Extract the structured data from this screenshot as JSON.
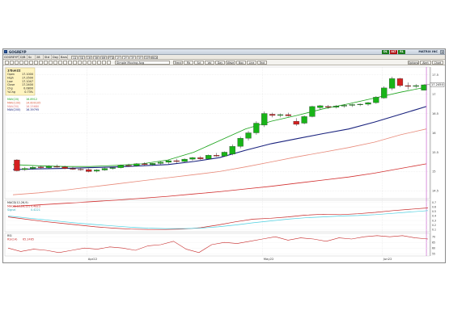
{
  "window": {
    "title": "GOGREYP",
    "title_right": "MATRIX INC",
    "status_buttons": [
      {
        "label": "DL",
        "color": "#1a7a1a"
      },
      {
        "label": "ALT",
        "color": "#b01414"
      },
      {
        "label": "RL",
        "color": "#1a7a1a"
      }
    ]
  },
  "toolbar1": {
    "symbol_field": "GOGREYP",
    "items": [
      "D/B",
      "Sc",
      "28",
      "Std",
      "Day",
      "Bars"
    ],
    "period_buttons": [
      "1D",
      "5D",
      "1M",
      "3M",
      "6M",
      "YTD",
      "1Y",
      "2Y",
      "3Y",
      "5Y",
      "10Y",
      "MAX"
    ]
  },
  "toolbar2": {
    "combo": "Simple Moving Avg",
    "menus": [
      "Trend",
      "Fib",
      "Sct",
      "Vol",
      "Day",
      "Wave",
      "Box",
      "Line",
      "Text"
    ],
    "right_buttons": [
      "Options",
      "Alert",
      "Chart"
    ]
  },
  "legend": {
    "header": "17Jun22",
    "fields": [
      {
        "label": "Open",
        "value": "17.1000"
      },
      {
        "label": "High",
        "value": "17.2500"
      },
      {
        "label": "Low",
        "value": "17.1047"
      },
      {
        "label": "Close",
        "value": "17.2400"
      },
      {
        "label": "Chg",
        "value": "0.0800"
      },
      {
        "label": "%Chg",
        "value": "0.73%"
      }
    ],
    "ma_lines": [
      {
        "label": "MAV(20)",
        "value": "16.8912",
        "color": "#1aa31a"
      },
      {
        "label": "MAV(100)",
        "value": "14.600105",
        "color": "#d95a3c"
      },
      {
        "label": "MAV(50)",
        "value": "16.25680",
        "color": "#e07474"
      },
      {
        "label": "MAV(200)",
        "value": "16.39795",
        "color": "#1a237e"
      }
    ]
  },
  "macd": {
    "title": "MACD(12,26,9)",
    "line": "MACD(12,26,12)",
    "value": "0.4823",
    "signal_label": "Signal",
    "signal_value": "0.4221"
  },
  "rsi": {
    "title": "RSI",
    "line": "RSI(14)",
    "value": "65.2465"
  },
  "price_box": "17.2450",
  "x_labels": [
    "Apr22",
    "May22",
    "Jun22"
  ],
  "price_ticks": [
    "17.5",
    "17",
    "16.5",
    "16",
    "15.5",
    "15",
    "14.5"
  ],
  "macd_ticks": [
    "0.7",
    "0.6",
    "0.5",
    "0.4",
    "0.3",
    "0.2",
    "0.1"
  ],
  "rsi_ticks": [
    "70",
    "65",
    "60",
    "55"
  ],
  "chart_data": [
    {
      "type": "line",
      "title": "GOGREYP",
      "subtitle": "Daily candlestick with moving averages",
      "x_range": [
        "2022-03-18",
        "2022-06-17"
      ],
      "ylim": [
        14.3,
        17.7
      ],
      "candles": [
        {
          "o": 15.3,
          "h": 15.32,
          "l": 15.0,
          "c": 15.02
        },
        {
          "o": 15.05,
          "h": 15.12,
          "l": 15.02,
          "c": 15.08
        },
        {
          "o": 15.08,
          "h": 15.14,
          "l": 15.05,
          "c": 15.11
        },
        {
          "o": 15.12,
          "h": 15.15,
          "l": 15.07,
          "c": 15.1
        },
        {
          "o": 15.1,
          "h": 15.16,
          "l": 15.08,
          "c": 15.14
        },
        {
          "o": 15.13,
          "h": 15.18,
          "l": 15.1,
          "c": 15.12
        },
        {
          "o": 15.12,
          "h": 15.15,
          "l": 15.06,
          "c": 15.08
        },
        {
          "o": 15.08,
          "h": 15.12,
          "l": 15.04,
          "c": 15.06
        },
        {
          "o": 15.06,
          "h": 15.1,
          "l": 15.02,
          "c": 15.05
        },
        {
          "o": 15.05,
          "h": 15.08,
          "l": 14.98,
          "c": 15.0
        },
        {
          "o": 15.01,
          "h": 15.06,
          "l": 14.98,
          "c": 15.04
        },
        {
          "o": 15.04,
          "h": 15.1,
          "l": 15.02,
          "c": 15.08
        },
        {
          "o": 15.08,
          "h": 15.12,
          "l": 15.05,
          "c": 15.1
        },
        {
          "o": 15.1,
          "h": 15.18,
          "l": 15.08,
          "c": 15.16
        },
        {
          "o": 15.16,
          "h": 15.2,
          "l": 15.12,
          "c": 15.15
        },
        {
          "o": 15.15,
          "h": 15.22,
          "l": 15.13,
          "c": 15.2
        },
        {
          "o": 15.2,
          "h": 15.24,
          "l": 15.16,
          "c": 15.18
        },
        {
          "o": 15.18,
          "h": 15.22,
          "l": 15.15,
          "c": 15.21
        },
        {
          "o": 15.21,
          "h": 15.26,
          "l": 15.18,
          "c": 15.24
        },
        {
          "o": 15.24,
          "h": 15.3,
          "l": 15.2,
          "c": 15.28
        },
        {
          "o": 15.28,
          "h": 15.33,
          "l": 15.22,
          "c": 15.26
        },
        {
          "o": 15.26,
          "h": 15.34,
          "l": 15.24,
          "c": 15.32
        },
        {
          "o": 15.32,
          "h": 15.38,
          "l": 15.28,
          "c": 15.36
        },
        {
          "o": 15.36,
          "h": 15.4,
          "l": 15.3,
          "c": 15.33
        },
        {
          "o": 15.33,
          "h": 15.44,
          "l": 15.32,
          "c": 15.42
        },
        {
          "o": 15.42,
          "h": 15.48,
          "l": 15.38,
          "c": 15.4
        },
        {
          "o": 15.4,
          "h": 15.52,
          "l": 15.38,
          "c": 15.5
        },
        {
          "o": 15.45,
          "h": 15.7,
          "l": 15.42,
          "c": 15.65
        },
        {
          "o": 15.65,
          "h": 15.9,
          "l": 15.6,
          "c": 15.86
        },
        {
          "o": 15.86,
          "h": 16.05,
          "l": 15.8,
          "c": 16.0
        },
        {
          "o": 16.0,
          "h": 16.3,
          "l": 15.95,
          "c": 16.25
        },
        {
          "o": 16.2,
          "h": 16.55,
          "l": 16.15,
          "c": 16.5
        },
        {
          "o": 16.48,
          "h": 16.52,
          "l": 16.4,
          "c": 16.45
        },
        {
          "o": 16.45,
          "h": 16.5,
          "l": 16.4,
          "c": 16.47
        },
        {
          "o": 16.47,
          "h": 16.52,
          "l": 16.42,
          "c": 16.44
        },
        {
          "o": 16.3,
          "h": 16.38,
          "l": 16.18,
          "c": 16.22
        },
        {
          "o": 16.25,
          "h": 16.45,
          "l": 16.22,
          "c": 16.42
        },
        {
          "o": 16.42,
          "h": 16.7,
          "l": 16.4,
          "c": 16.68
        },
        {
          "o": 16.65,
          "h": 16.72,
          "l": 16.6,
          "c": 16.7
        },
        {
          "o": 16.68,
          "h": 16.72,
          "l": 16.62,
          "c": 16.66
        },
        {
          "o": 16.66,
          "h": 16.72,
          "l": 16.63,
          "c": 16.69
        },
        {
          "o": 16.69,
          "h": 16.74,
          "l": 16.65,
          "c": 16.71
        },
        {
          "o": 16.71,
          "h": 16.75,
          "l": 16.67,
          "c": 16.73
        },
        {
          "o": 16.73,
          "h": 16.76,
          "l": 16.69,
          "c": 16.74
        },
        {
          "o": 16.74,
          "h": 16.8,
          "l": 16.7,
          "c": 16.78
        },
        {
          "o": 16.78,
          "h": 16.95,
          "l": 16.75,
          "c": 16.92
        },
        {
          "o": 16.9,
          "h": 17.2,
          "l": 16.88,
          "c": 17.16
        },
        {
          "o": 17.15,
          "h": 17.45,
          "l": 17.1,
          "c": 17.4
        },
        {
          "o": 17.4,
          "h": 17.42,
          "l": 17.18,
          "c": 17.22
        },
        {
          "o": 17.22,
          "h": 17.3,
          "l": 17.12,
          "c": 17.2
        },
        {
          "o": 17.2,
          "h": 17.26,
          "l": 17.15,
          "c": 17.22
        },
        {
          "o": 17.1,
          "h": 17.25,
          "l": 17.1,
          "c": 17.24
        }
      ],
      "series": [
        {
          "name": "MAV(20)",
          "color": "#1aa31a",
          "values": [
            15.18,
            15.15,
            15.13,
            15.13,
            15.16,
            15.2,
            15.3,
            15.5,
            15.8,
            16.1,
            16.3,
            16.45,
            16.62,
            16.75,
            16.9,
            17.05,
            17.18
          ]
        },
        {
          "name": "MAV(50)",
          "color": "#1a237e",
          "values": [
            15.05,
            15.07,
            15.08,
            15.1,
            15.12,
            15.15,
            15.18,
            15.26,
            15.36,
            15.55,
            15.72,
            15.85,
            15.98,
            16.1,
            16.28,
            16.48,
            16.68
          ]
        },
        {
          "name": "MAV(100)",
          "color": "#e88a7a",
          "values": [
            14.4,
            14.45,
            14.52,
            14.6,
            14.68,
            14.76,
            14.84,
            14.92,
            15.0,
            15.12,
            15.25,
            15.38,
            15.5,
            15.62,
            15.76,
            15.95,
            16.1
          ]
        },
        {
          "name": "MAV(200)",
          "color": "#d23030",
          "values": [
            14.1,
            14.14,
            14.18,
            14.22,
            14.26,
            14.31,
            14.36,
            14.42,
            14.48,
            14.55,
            14.62,
            14.7,
            14.78,
            14.86,
            14.96,
            15.08,
            15.2
          ]
        }
      ]
    },
    {
      "type": "line",
      "title": "MACD(12,26,9)",
      "ylim": [
        0.05,
        0.75
      ],
      "series": [
        {
          "name": "MACD(12,26,12)",
          "color": "#c62828",
          "values": [
            0.38,
            0.33,
            0.28,
            0.24,
            0.2,
            0.16,
            0.13,
            0.11,
            0.1,
            0.1,
            0.11,
            0.14,
            0.2,
            0.27,
            0.33,
            0.35,
            0.38,
            0.42,
            0.44,
            0.43,
            0.45,
            0.48,
            0.52,
            0.55,
            0.58
          ]
        },
        {
          "name": "Signal",
          "color": "#4dd0e1",
          "values": [
            0.4,
            0.36,
            0.32,
            0.28,
            0.24,
            0.21,
            0.18,
            0.15,
            0.13,
            0.12,
            0.12,
            0.13,
            0.16,
            0.2,
            0.25,
            0.29,
            0.33,
            0.36,
            0.38,
            0.4,
            0.41,
            0.43,
            0.46,
            0.49,
            0.52
          ]
        }
      ]
    },
    {
      "type": "line",
      "title": "RSI",
      "ylim": [
        53,
        73
      ],
      "series": [
        {
          "name": "RSI(14)",
          "color": "#c62828",
          "values": [
            60,
            57,
            59,
            58,
            56,
            58,
            60,
            59,
            61,
            60,
            58,
            62,
            63,
            66,
            59,
            56,
            63,
            65,
            64,
            66,
            68,
            70,
            67,
            69,
            68,
            66,
            69,
            68,
            70,
            71,
            70,
            71,
            69,
            68
          ]
        }
      ]
    }
  ]
}
